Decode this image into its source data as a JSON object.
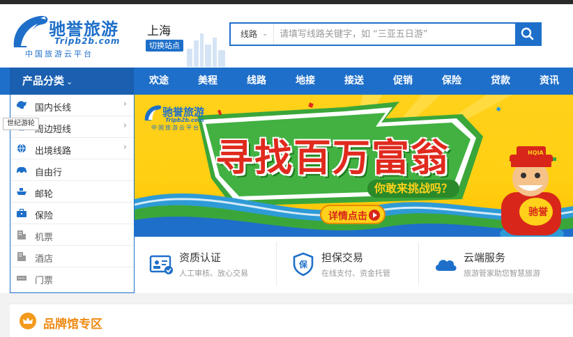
{
  "header": {
    "brand_name": "驰誉旅游",
    "brand_domain": "Tripb2b.com",
    "brand_slogan": "中国旅游云平台",
    "city": "上海",
    "switch_site_label": "切换站点"
  },
  "search": {
    "type_label": "线路",
    "placeholder": "请填写线路关键字，如 “三亚五日游”"
  },
  "nav": {
    "category_label": "产品分类",
    "items": [
      {
        "label": "欢途"
      },
      {
        "label": "美程"
      },
      {
        "label": "线路"
      },
      {
        "label": "地接"
      },
      {
        "label": "接送"
      },
      {
        "label": "促销"
      },
      {
        "label": "保险"
      },
      {
        "label": "贷款"
      },
      {
        "label": "资讯"
      }
    ]
  },
  "sidebar": {
    "tooltip": "世纪游轮",
    "items": [
      {
        "label": "国内长线",
        "icon": "china-map-icon"
      },
      {
        "label": "周边短线",
        "icon": "globe-icon"
      },
      {
        "label": "出境线路",
        "icon": "globe-icon"
      },
      {
        "label": "自由行",
        "icon": "car-icon"
      },
      {
        "label": "邮轮",
        "icon": "ship-icon"
      },
      {
        "label": "保险",
        "icon": "briefcase-icon"
      },
      {
        "label": "机票",
        "icon": "building-icon"
      },
      {
        "label": "酒店",
        "icon": "building-icon"
      },
      {
        "label": "门票",
        "icon": "ticket-icon"
      }
    ]
  },
  "banner": {
    "logo_brand": "驰誉旅游",
    "logo_domain": "Tripb2b.com",
    "logo_slogan": "中国旅游云平台",
    "headline": "寻找百万富翁",
    "subline": "你敢来挑战吗？",
    "cta_label": "详情点击",
    "mascot_hat_text": "HQIA",
    "mascot_bag_text": "驰誉"
  },
  "features": [
    {
      "title": "资质认证",
      "subtitle": "人工审核、放心交易",
      "icon": "id-card-icon"
    },
    {
      "title": "担保交易",
      "subtitle": "在线支付、资金托管",
      "icon": "shield-icon"
    },
    {
      "title": "云端服务",
      "subtitle": "旅游管家助您智慧旅游",
      "icon": "cloud-icon"
    }
  ],
  "brand_zone": {
    "title": "品牌馆专区",
    "icon": "crown-icon"
  },
  "colors": {
    "primary_blue": "#1e6fc9",
    "banner_yellow": "#ffd11a",
    "headline_red": "#e02a1e",
    "accent_orange": "#f08a12"
  }
}
